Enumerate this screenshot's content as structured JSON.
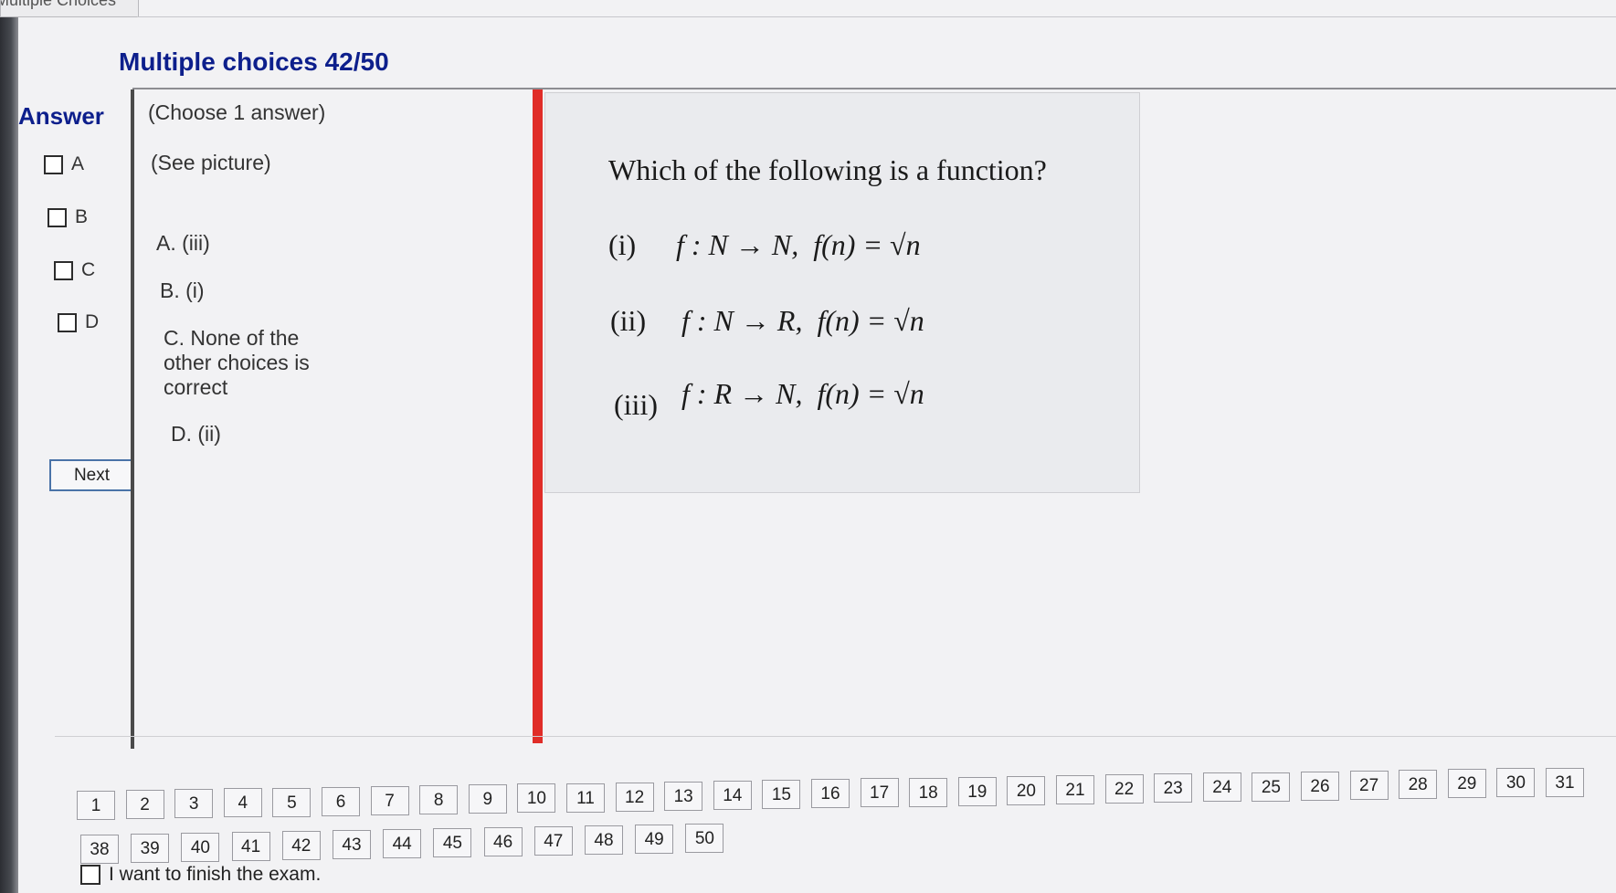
{
  "window": {
    "tab_title": "Multiple Choices"
  },
  "header": {
    "title": "Multiple choices 42/50"
  },
  "answer": {
    "label": "Answer",
    "options": [
      "A",
      "B",
      "C",
      "D"
    ]
  },
  "next_label": "Next",
  "choices_panel": {
    "instruction": "(Choose 1 answer)",
    "see_picture": "(See picture)",
    "choices": [
      {
        "letter": "A.",
        "text": "(iii)"
      },
      {
        "letter": "B.",
        "text": "(i)"
      },
      {
        "letter": "C.",
        "text": "None of the other choices is correct"
      },
      {
        "letter": "D.",
        "text": "(ii)"
      }
    ]
  },
  "picture": {
    "question": "Which of the following is a function?",
    "statements": [
      {
        "num": "(i)",
        "map": "f : N → N,",
        "formula": "f(n) = √n"
      },
      {
        "num": "(ii)",
        "map": "f : N → R,",
        "formula": "f(n) = √n"
      },
      {
        "num": "(iii)",
        "map": "f : R → N,",
        "formula": "f(n) = √n"
      }
    ]
  },
  "pagination": {
    "row1": [
      "1",
      "2",
      "3",
      "4",
      "5",
      "6",
      "7",
      "8",
      "9",
      "10",
      "11",
      "12",
      "13",
      "14",
      "15",
      "16",
      "17",
      "18",
      "19",
      "20",
      "21",
      "22",
      "23",
      "24",
      "25",
      "26",
      "27",
      "28",
      "29",
      "30",
      "31"
    ],
    "row2": [
      "38",
      "39",
      "40",
      "41",
      "42",
      "43",
      "44",
      "45",
      "46",
      "47",
      "48",
      "49",
      "50"
    ]
  },
  "finish_label": "I want to finish the exam."
}
